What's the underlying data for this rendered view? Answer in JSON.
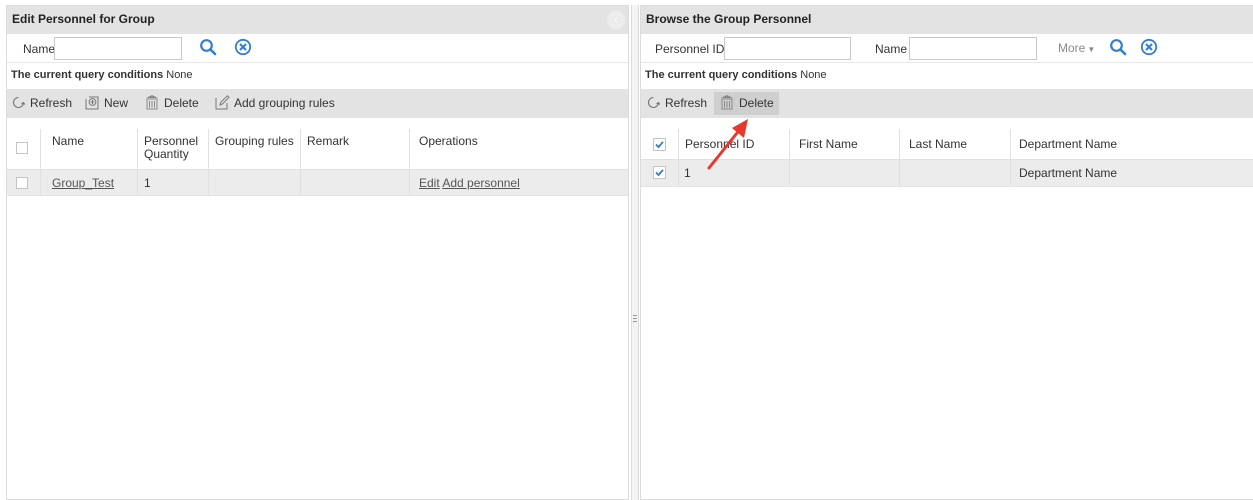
{
  "left": {
    "title": "Edit Personnel for Group",
    "collapse_glyph": "‹",
    "search": {
      "name_label": "Name",
      "name_value": "",
      "search_icon": "search-icon",
      "clear_icon": "clear-circle-icon"
    },
    "query": {
      "label": "The current query conditions",
      "value": "None"
    },
    "toolbar": {
      "refresh": "Refresh",
      "new": "New",
      "delete": "Delete",
      "add_rules": "Add grouping rules"
    },
    "columns": [
      "Name",
      "Personnel Quantity",
      "Grouping rules",
      "Remark",
      "Operations"
    ],
    "rows": [
      {
        "name": "Group_Test",
        "quantity": "1",
        "rules": "",
        "remark": "",
        "op_edit": "Edit",
        "op_add": "Add personnel"
      }
    ]
  },
  "right": {
    "title": "Browse the Group Personnel",
    "search": {
      "pid_label": "Personnel ID",
      "pid_value": "",
      "name_label": "Name",
      "name_value": "",
      "more_label": "More",
      "search_icon": "search-icon",
      "clear_icon": "clear-circle-icon"
    },
    "query": {
      "label": "The current query conditions",
      "value": "None"
    },
    "toolbar": {
      "refresh": "Refresh",
      "delete": "Delete"
    },
    "columns": [
      "Personnel ID",
      "First Name",
      "Last Name",
      "Department Name"
    ],
    "rows": [
      {
        "pid": "1",
        "first": "",
        "last": "",
        "dept": "Department Name",
        "checked": true
      }
    ]
  },
  "colors": {
    "accent_blue": "#2f7fd6",
    "header_bg": "#e3e3e3",
    "arrow_red": "#e8372e"
  }
}
